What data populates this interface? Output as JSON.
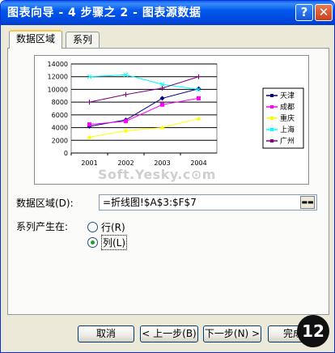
{
  "window": {
    "title": "图表向导 - 4 步骤之 2 - 图表源数据",
    "help_button": "?",
    "close_button": "✕"
  },
  "tabs": [
    "数据区域",
    "系列"
  ],
  "data_range": {
    "label": "数据区域(D):",
    "value": "=折线图!$A$3:$F$7",
    "collapse_icon": "range-collapse-icon"
  },
  "series_in": {
    "label": "系列产生在:",
    "options": [
      {
        "label": "行(R)",
        "selected": false
      },
      {
        "label": "列(L)",
        "selected": true
      }
    ]
  },
  "buttons": {
    "cancel": "取消",
    "back": "< 上一步(B)",
    "next": "下一步(N) >",
    "finish": "完成"
  },
  "watermark": "Soft.Yesky.c⊙m",
  "badge": "12",
  "chart_data": {
    "type": "line",
    "categories": [
      "2001",
      "2002",
      "2003",
      "2004"
    ],
    "ylim": [
      0,
      14000
    ],
    "yticks": [
      "0",
      "2000",
      "4000",
      "6000",
      "8000",
      "10000",
      "12000",
      "14000"
    ],
    "grid": true,
    "legend_position": "right",
    "series": [
      {
        "name": "天津",
        "color": "#000080",
        "marker": "diamond",
        "values": [
          4200,
          5200,
          8600,
          10100
        ]
      },
      {
        "name": "成都",
        "color": "#ff00ff",
        "marker": "square",
        "values": [
          4500,
          5000,
          7600,
          8600
        ]
      },
      {
        "name": "重庆",
        "color": "#ffff00",
        "marker": "triangle",
        "values": [
          2500,
          3500,
          4000,
          5400
        ]
      },
      {
        "name": "上海",
        "color": "#00ffff",
        "marker": "x",
        "values": [
          12000,
          12300,
          10800,
          10000
        ]
      },
      {
        "name": "广州",
        "color": "#800080",
        "marker": "asterisk",
        "values": [
          8000,
          9200,
          10200,
          12000
        ]
      }
    ]
  }
}
